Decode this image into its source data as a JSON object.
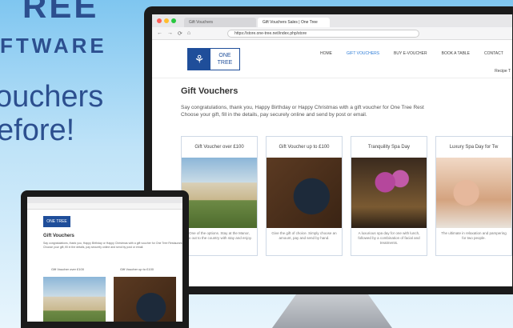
{
  "hero": {
    "brand_top": "REE",
    "brand_sub": "FTWARE",
    "tagline_line1": "ouchers",
    "tagline_line2": "efore!"
  },
  "browser": {
    "tabs": [
      {
        "label": "Gift Vouchers",
        "active": false
      },
      {
        "label": "Gift Vouchers Sales | One Tree",
        "active": true
      }
    ],
    "url": "https://store.one-tree.net/index.php/store",
    "nav_back": "←",
    "nav_forward": "→",
    "nav_reload": "⟳",
    "nav_home": "⌂"
  },
  "site": {
    "logo_left": "⚘",
    "logo_right_1": "ONE",
    "logo_right_2": "TREE",
    "nav": [
      {
        "label": "HOME",
        "active": false
      },
      {
        "label": "GIFT VOUCHERS",
        "active": true
      },
      {
        "label": "BUY E-VOUCHER",
        "active": false
      },
      {
        "label": "BOOK A TABLE",
        "active": false
      },
      {
        "label": "CONTACT",
        "active": false
      }
    ],
    "nav_right": "Recipe T",
    "page_title": "Gift Vouchers",
    "intro_line1": "Say congratulations, thank you, Happy Birthday or Happy Christmas with a gift voucher for One Tree Rest",
    "intro_line2": "Choose your gift, fill in the details, pay securely online and send by post or email.",
    "cards": [
      {
        "title": "Gift Voucher over £100",
        "desc": "One of the options. Stay at the Manor, go out to the country with stay and enjoy."
      },
      {
        "title": "Gift Voucher up to £100",
        "desc": "Give the gift of choice. Simply choose an amount, pay and send by hand."
      },
      {
        "title": "Tranquility Spa Day",
        "desc": "A luxurious spa day for one with lunch, followed by a combination of facial and treatments."
      },
      {
        "title": "Luxury Spa Day for Tw",
        "desc": "The ultimate in relaxation and pampering for two people."
      }
    ]
  },
  "laptop": {
    "logo": "ONE TREE",
    "title": "Gift Vouchers",
    "intro": "Say congratulations, thank you, Happy Birthday or Happy Christmas with a gift voucher for One Tree Restaurant. Choose your gift, fill in the details, pay securely online and send by post or email.",
    "card1": "Gift Voucher over £100",
    "card2": "Gift Voucher up to £100"
  },
  "colors": {
    "brand": "#1f4e9a",
    "nav_active": "#2b7bd6",
    "hero_text": "#2c4f8f"
  }
}
